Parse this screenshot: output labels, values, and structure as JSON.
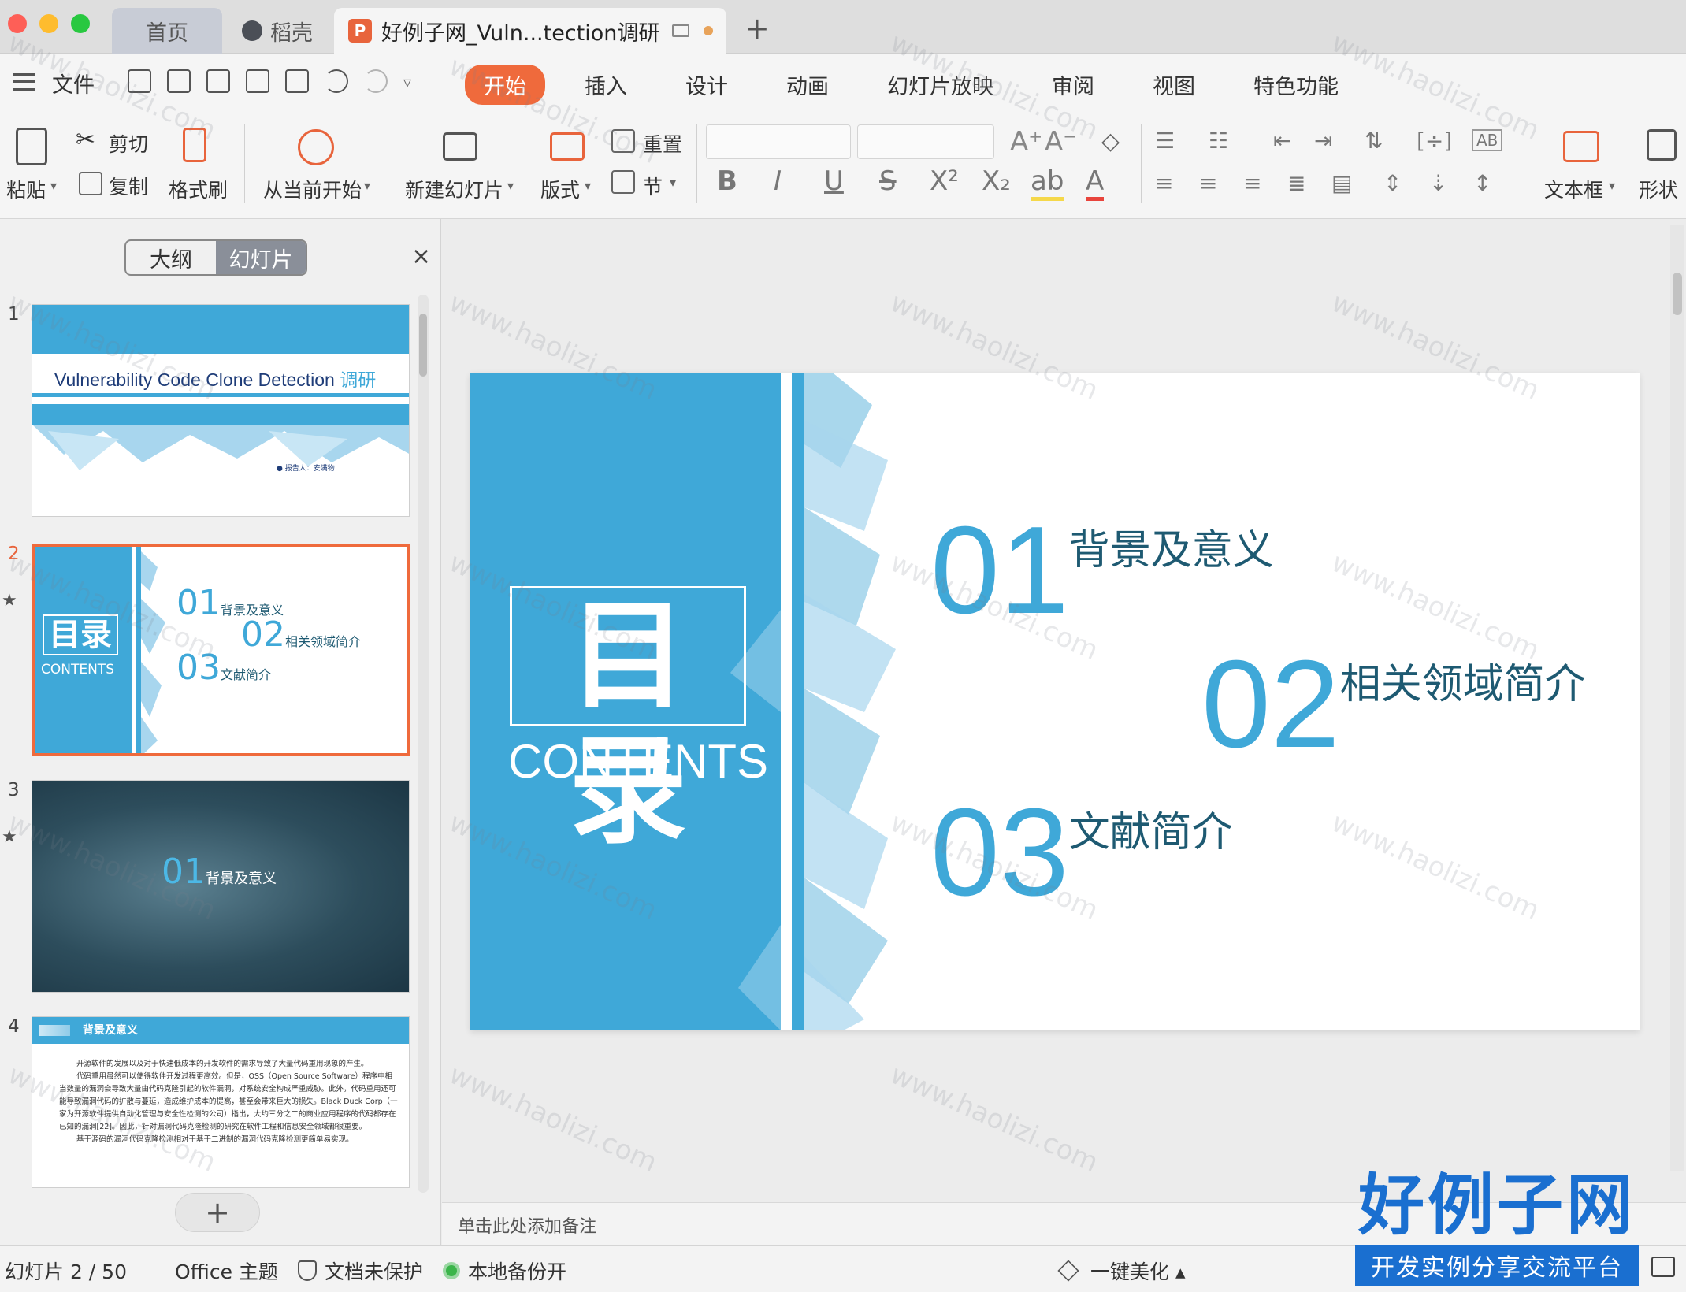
{
  "tabs": {
    "home": "首页",
    "docer": "稻壳",
    "document": "好例子网_Vuln...tection调研",
    "new_tab": "+"
  },
  "menubar": {
    "file": "文件",
    "items": [
      "开始",
      "插入",
      "设计",
      "动画",
      "幻灯片放映",
      "审阅",
      "视图",
      "特色功能"
    ],
    "active": "开始"
  },
  "ribbon": {
    "paste": "粘贴",
    "cut": "剪切",
    "copy": "复制",
    "format_painter": "格式刷",
    "play_from_current": "从当前开始",
    "new_slide": "新建幻灯片",
    "layout": "版式",
    "reset": "重置",
    "section": "节",
    "textbox": "文本框",
    "shape": "形状"
  },
  "left_pane": {
    "tab_outline": "大纲",
    "tab_slides": "幻灯片",
    "close": "×",
    "add": "+",
    "slides": [
      {
        "num": "1",
        "title": "Vulnerability Code Clone Detection",
        "title_cn": "调研",
        "reporter": "● 报告人：安满物"
      },
      {
        "num": "2",
        "big": "目录",
        "contents": "CONTENTS",
        "items": [
          {
            "n": "01",
            "t": "背景及意义"
          },
          {
            "n": "02",
            "t": "相关领域简介"
          },
          {
            "n": "03",
            "t": "文献简介"
          }
        ]
      },
      {
        "num": "3",
        "n": "01",
        "t": "背景及意义"
      },
      {
        "num": "4",
        "header": "背景及意义",
        "paragraphs": [
          "开源软件的发展以及对于快速低成本的开发软件的需求导致了大量代码重用现象的产生。",
          "代码重用虽然可以使得软件开发过程更高效。但是，OSS（Open Source Software）程序中相当数量的漏洞会导致大量由代码克隆引起的软件漏洞，对系统安全构成严重威胁。此外，代码重用还可能导致漏洞代码的扩散与蔓延，造成维护成本的提高，甚至会带来巨大的损失。Black Duck Corp（一家为开源软件提供自动化管理与安全性检测的公司）指出，大约三分之二的商业应用程序的代码都存在已知的漏洞[22]。因此，针对漏洞代码克隆检测的研究在软件工程和信息安全领域都很重要。",
          "基于源码的漏洞代码克隆检测相对于基于二进制的漏洞代码克隆检测更简单易实现。"
        ]
      }
    ]
  },
  "slide": {
    "big_title": "目录",
    "contents": "CONTENTS",
    "items": [
      {
        "num": "01",
        "text": "背景及意义"
      },
      {
        "num": "02",
        "text": "相关领域简介"
      },
      {
        "num": "03",
        "text": "文献简介"
      }
    ],
    "accent": "#3fa8d8",
    "text_color": "#1e5a72"
  },
  "notes_placeholder": "单击此处添加备注",
  "statusbar": {
    "slide_counter": "幻灯片 2 / 50",
    "theme": "Office 主题",
    "protection": "文档未保护",
    "backup": "本地备份开",
    "beautify": "一键美化 ▴"
  },
  "logo": {
    "main": "好例子网",
    "sub": "开发实例分享交流平台"
  },
  "watermark": "www.haolizi.com"
}
